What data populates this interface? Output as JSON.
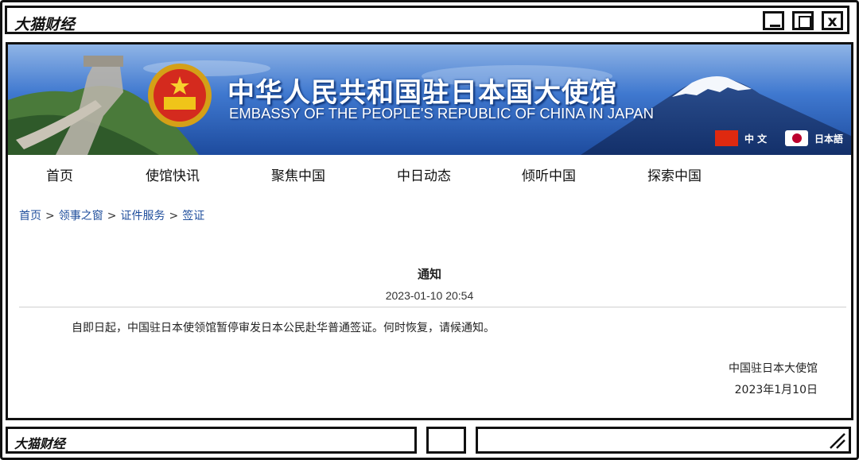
{
  "window": {
    "title": "大猫财经",
    "controls": {
      "minimize": "minimize-icon",
      "maximize": "maximize-icon",
      "close": "x"
    }
  },
  "banner": {
    "title_cn": "中华人民共和国驻日本国大使馆",
    "title_en": "EMBASSY OF THE PEOPLE'S REPUBLIC OF CHINA IN JAPAN",
    "languages": [
      {
        "label": "中 文",
        "flag": "cn-flag-icon"
      },
      {
        "label": "日本語",
        "flag": "jp-flag-icon"
      }
    ],
    "colors": {
      "sky": "#2f6bc4",
      "deep": "#1b3f8a"
    }
  },
  "nav": [
    "首页",
    "使馆快讯",
    "聚焦中国",
    "中日动态",
    "倾听中国",
    "探索中国"
  ],
  "breadcrumb": {
    "items": [
      "首页",
      "领事之窗",
      "证件服务",
      "签证"
    ],
    "separator": ">"
  },
  "notice": {
    "title": "通知",
    "datetime": "2023-01-10 20:54",
    "body": "自即日起，中国驻日本使领馆暂停审发日本公民赴华普通签证。何时恢复，请候通知。",
    "signature": "中国驻日本大使馆",
    "signature_date": "2023年1月10日"
  },
  "footer": {
    "label": "大猫财经"
  }
}
